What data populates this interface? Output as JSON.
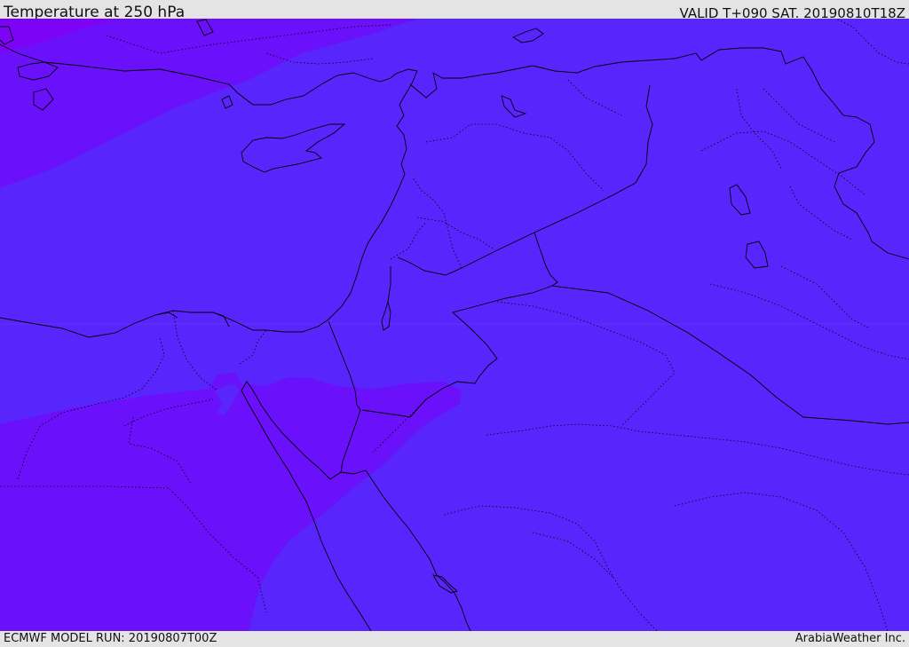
{
  "header": {
    "title": "Temperature at 250 hPa",
    "valid_time": "VALID T+090 SAT. 20190810T18Z"
  },
  "footer": {
    "model_run": "ECMWF MODEL RUN: 20190807T00Z",
    "credit": "ArabiaWeather Inc."
  },
  "colors": {
    "temperature_band_main": "#5826fd",
    "temperature_band_cooler": "#6a10fa",
    "temperature_band_coolest": "#8000f5",
    "border_line": "#000000",
    "background": "#e4e4e4"
  }
}
